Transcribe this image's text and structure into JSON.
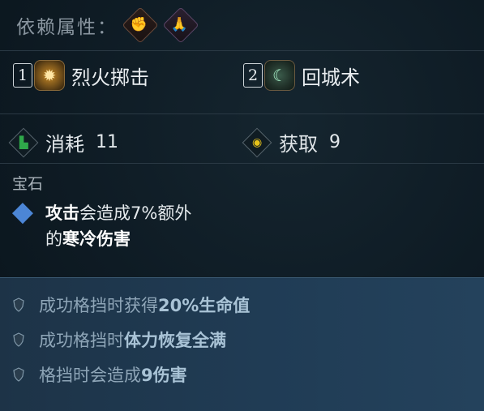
{
  "attributes": {
    "label": "依赖属性：",
    "icons": [
      "strength-icon",
      "prayer-hands-icon"
    ]
  },
  "skills": [
    {
      "key": "1",
      "name": "烈火掷击",
      "icon": "fire-throw-icon"
    },
    {
      "key": "2",
      "name": "回城术",
      "icon": "town-portal-icon"
    }
  ],
  "stats": {
    "cost_label": "消耗",
    "cost_value": "11",
    "gain_label": "获取",
    "gain_value": "9"
  },
  "gem": {
    "title": "宝石",
    "line1_a": "攻击",
    "line1_b": "会造成7%额外",
    "line2_a": "的",
    "line2_b": "寒冷伤害"
  },
  "perks": [
    {
      "a": "成功格挡时获得",
      "b": "20%生命值"
    },
    {
      "a": "成功格挡时",
      "b": "体力恢复全满"
    },
    {
      "a": "格挡时会造成",
      "b": "9伤害"
    }
  ],
  "colors": {
    "background": "#0e1b24",
    "perk_panel": "#203c55",
    "gem_blue": "#4c86d6",
    "cost_green": "#2fa84a",
    "gain_yellow": "#e6c21a"
  }
}
